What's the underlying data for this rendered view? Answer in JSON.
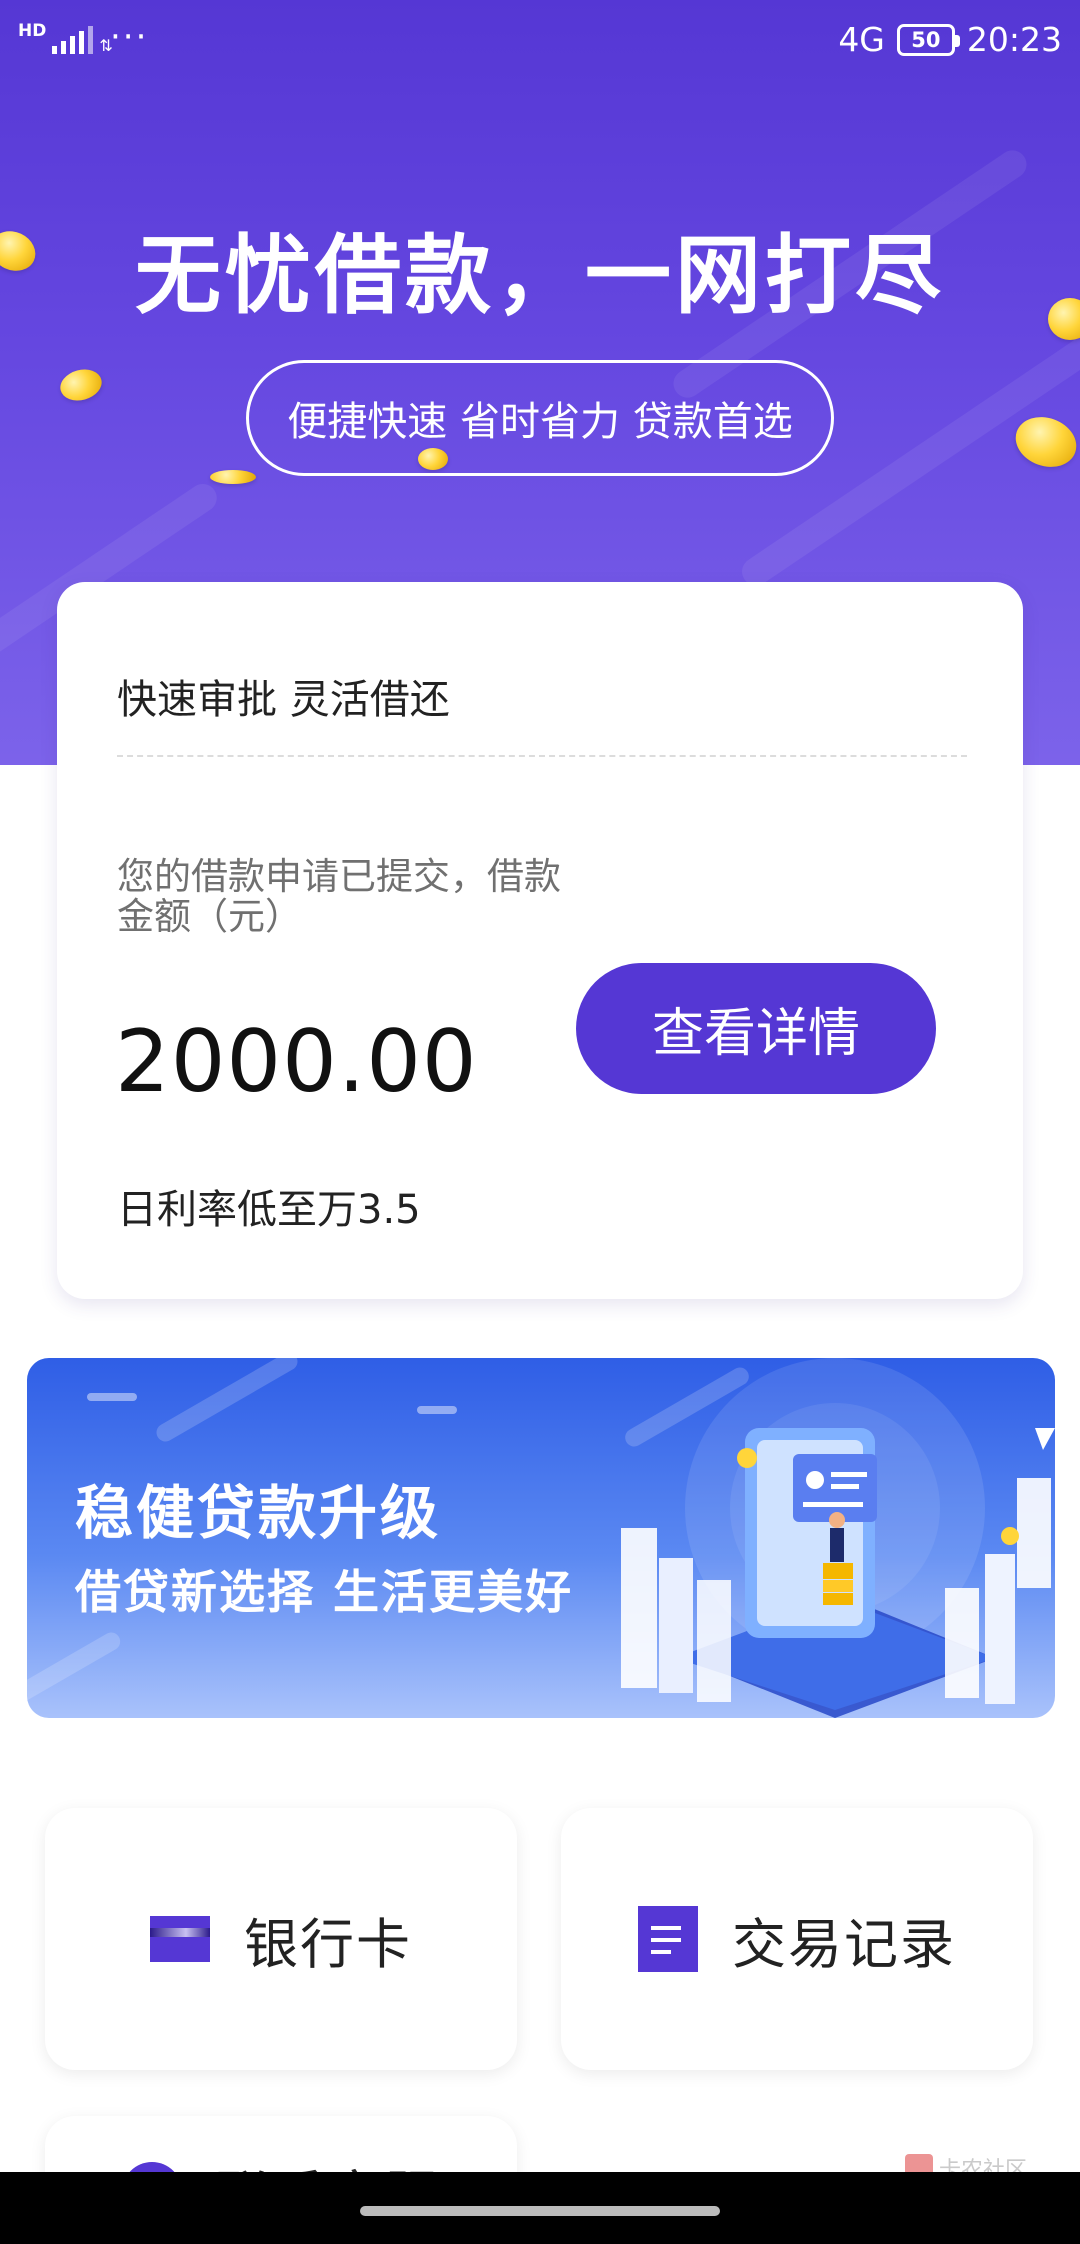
{
  "status_bar": {
    "hd_label": "HD",
    "more": "···",
    "network": "4G",
    "battery": "50",
    "time": "20:23"
  },
  "hero": {
    "headline": "无忧借款，一网打尽",
    "slogan": "便捷快速 省时省力 贷款首选"
  },
  "loan_card": {
    "title": "快速审批 灵活借还",
    "application_text": "您的借款申请已提交，借款金额（元）",
    "amount": "2000.00",
    "detail_button": "查看详情",
    "rate_text": "日利率低至万3.5"
  },
  "banner": {
    "title": "稳健贷款升级",
    "subtitle": "借贷新选择   生活更美好"
  },
  "quick_links": {
    "bank_card": "银行卡",
    "records": "交易记录",
    "contact": "联系客服"
  },
  "watermark": {
    "text": "卡农社区"
  },
  "icons": {
    "bank_card": "bank-card-icon",
    "records": "document-list-icon",
    "contact": "customer-service-icon"
  },
  "colors": {
    "brand": "#5537d4",
    "banner_blue": "#2f5ee6",
    "coin_gold": "#ffd53a"
  }
}
